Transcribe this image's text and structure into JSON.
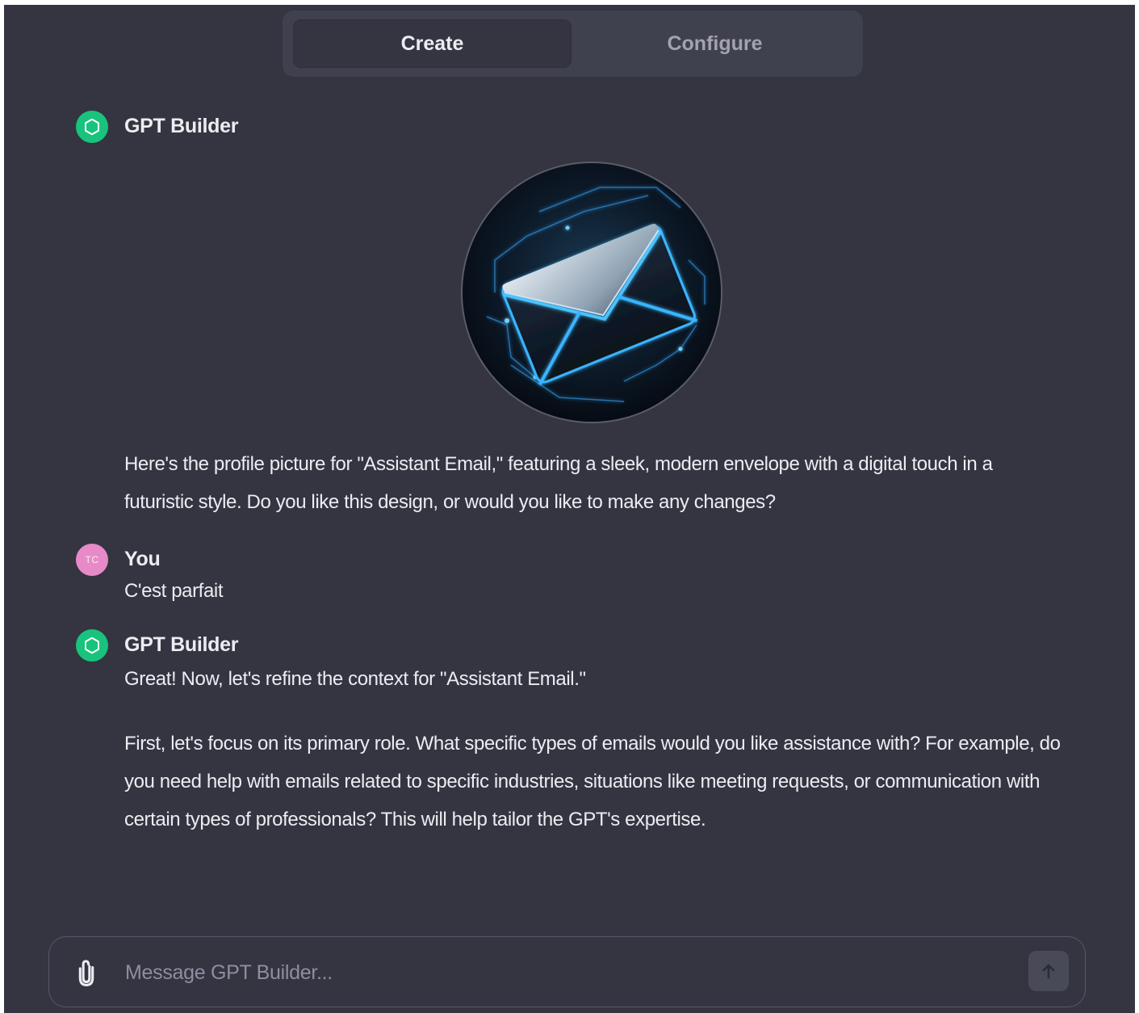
{
  "tabs": {
    "create_label": "Create",
    "configure_label": "Configure",
    "active": "Create"
  },
  "messages": [
    {
      "sender": "GPT Builder",
      "avatar_icon": "openai-logo-icon",
      "image": "envelope-profile-picture",
      "text": "Here's the profile picture for \"Assistant Email,\" featuring a sleek, modern envelope with a digital touch in a futuristic style. Do you like this design, or would you like to make any changes?"
    },
    {
      "sender": "You",
      "avatar_initials": "TC",
      "text": "C'est parfait"
    },
    {
      "sender": "GPT Builder",
      "avatar_icon": "openai-logo-icon",
      "paragraph_1": "Great! Now, let's refine the context for \"Assistant Email.\"",
      "paragraph_2": "First, let's focus on its primary role. What specific types of emails would you like assistance with? For example, do you need help with emails related to specific industries, situations like meeting requests, or communication with certain types of professionals? This will help tailor the GPT's expertise."
    }
  ],
  "composer": {
    "placeholder": "Message GPT Builder...",
    "value": "",
    "attach_icon": "paperclip-icon",
    "send_icon": "arrow-up-icon"
  },
  "colors": {
    "background": "#343541",
    "segment_bg": "#40414f",
    "gpt_avatar": "#19c37d",
    "user_avatar": "#e88ac7",
    "text": "#ececf1",
    "muted_text": "#8e8ea0"
  }
}
